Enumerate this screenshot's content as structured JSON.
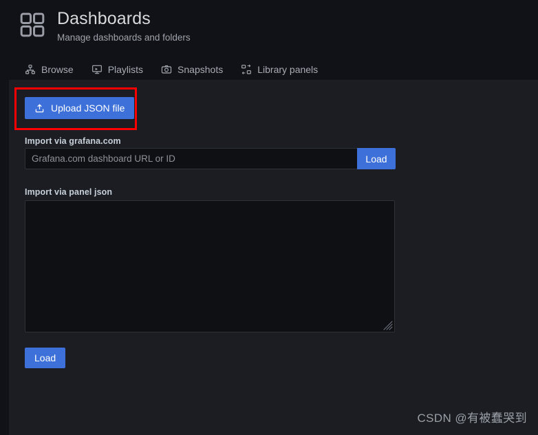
{
  "header": {
    "title": "Dashboards",
    "subtitle": "Manage dashboards and folders",
    "icon": "dashboards-grid-icon"
  },
  "tabs": [
    {
      "label": "Browse",
      "icon": "sitemap-icon",
      "active": false
    },
    {
      "label": "Playlists",
      "icon": "presentation-icon",
      "active": false
    },
    {
      "label": "Snapshots",
      "icon": "camera-icon",
      "active": false
    },
    {
      "label": "Library panels",
      "icon": "library-panels-icon",
      "active": false
    }
  ],
  "import": {
    "upload_button_label": "Upload JSON file",
    "upload_icon": "upload-icon",
    "grafana_com_label": "Import via grafana.com",
    "grafana_com_placeholder": "Grafana.com dashboard URL or ID",
    "grafana_com_value": "",
    "grafana_com_load_label": "Load",
    "panel_json_label": "Import via panel json",
    "panel_json_placeholder": "",
    "panel_json_value": "",
    "load_label": "Load"
  },
  "annotation": {
    "type": "highlight-rectangle",
    "color": "#ff0000",
    "target": "upload-json-file-button"
  },
  "watermark": {
    "text": "CSDN @有被蠢哭到"
  },
  "colors": {
    "app_background": "#111217",
    "content_background": "#1b1d23",
    "primary_button": "#3d71d9",
    "text_primary": "#ccccdc",
    "text_secondary": "#9fa3ab",
    "input_background": "#0e1013",
    "border": "#2c3235",
    "annotation": "#ff0000"
  }
}
